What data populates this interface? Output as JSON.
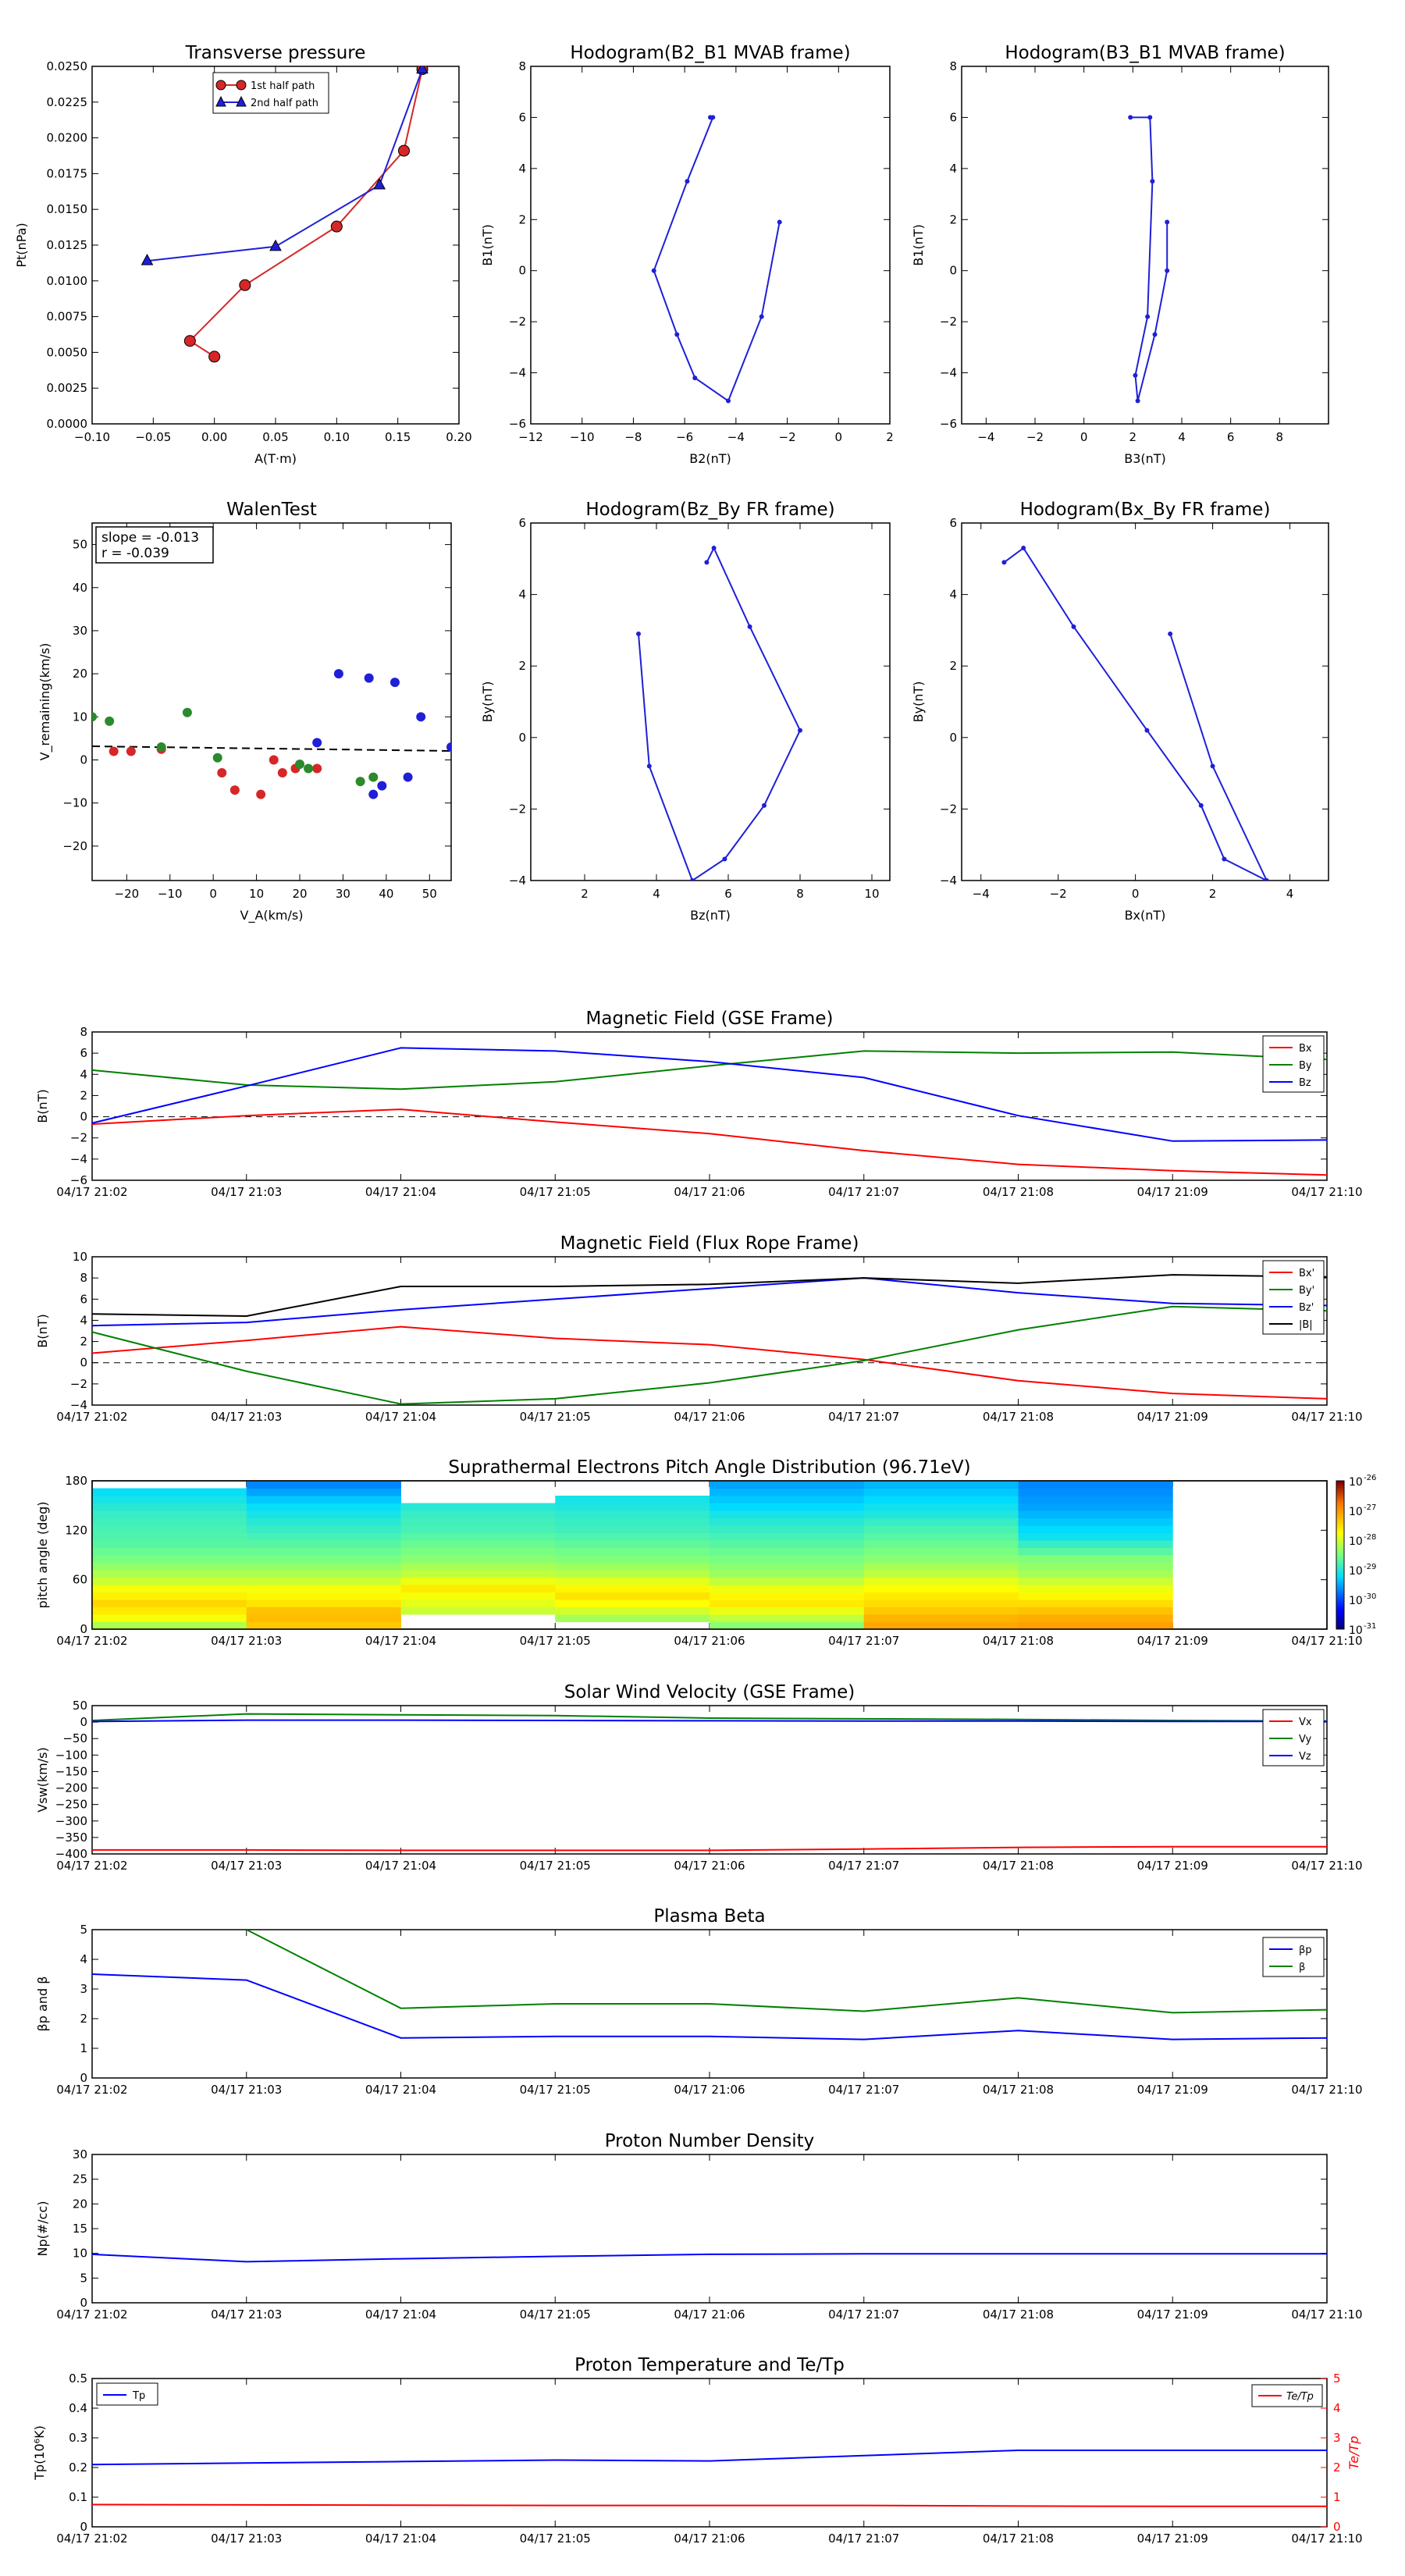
{
  "chart_data": [
    {
      "type": "line",
      "title": "Transverse pressure",
      "xlabel": "A(T·m)",
      "ylabel": "Pt(nPa)",
      "xlim": [
        -0.1,
        0.2
      ],
      "ylim": [
        0,
        0.025
      ],
      "xticks": [
        "−0.10",
        "−0.05",
        "0.00",
        "0.05",
        "0.10",
        "0.15",
        "0.20"
      ],
      "yticks": [
        "0.0000",
        "0.0025",
        "0.0050",
        "0.0075",
        "0.0100",
        "0.0125",
        "0.0150",
        "0.0175",
        "0.0200",
        "0.0225",
        "0.0250"
      ],
      "legend": [
        "1st half path",
        "2nd half path"
      ],
      "series": [
        {
          "name": "1st half path",
          "color": "#d62728",
          "marker": "circle",
          "x": [
            0.0,
            -0.02,
            0.025,
            0.1,
            0.155,
            0.17
          ],
          "y": [
            0.0047,
            0.0058,
            0.0097,
            0.0138,
            0.0191,
            0.0248
          ]
        },
        {
          "name": "2nd half path",
          "color": "#1f1fd8",
          "marker": "triangle",
          "x": [
            -0.055,
            0.05,
            0.135,
            0.17
          ],
          "y": [
            0.0114,
            0.0124,
            0.0167,
            0.0248
          ]
        }
      ]
    },
    {
      "type": "line",
      "title": "Hodogram(B2_B1 MVAB frame)",
      "xlabel": "B2(nT)",
      "ylabel": "B1(nT)",
      "xlim": [
        -12,
        2
      ],
      "ylim": [
        -6,
        8
      ],
      "xticks": [
        "−12",
        "−10",
        "−8",
        "−6",
        "−4",
        "−2",
        "0",
        "2"
      ],
      "yticks": [
        "−6",
        "−4",
        "−2",
        "0",
        "2",
        "4",
        "6",
        "8"
      ],
      "series": [
        {
          "color": "#1f1fd8",
          "x": [
            -2.3,
            -3.0,
            -4.3,
            -5.6,
            -6.3,
            -7.2,
            -5.9,
            -4.9,
            -5.0
          ],
          "y": [
            1.9,
            -1.8,
            -5.1,
            -4.2,
            -2.5,
            0.0,
            3.5,
            6.0,
            6.0
          ]
        }
      ]
    },
    {
      "type": "line",
      "title": "Hodogram(B3_B1 MVAB frame)",
      "xlabel": "B3(nT)",
      "ylabel": "B1(nT)",
      "xlim": [
        -5,
        10
      ],
      "ylim": [
        -6,
        8
      ],
      "xticks": [
        "−4",
        "−2",
        "0",
        "2",
        "4",
        "6",
        "8"
      ],
      "yticks": [
        "−6",
        "−4",
        "−2",
        "0",
        "2",
        "4",
        "6",
        "8"
      ],
      "series": [
        {
          "color": "#1f1fd8",
          "x": [
            3.4,
            3.4,
            2.9,
            2.2,
            2.1,
            2.6,
            2.8,
            2.7,
            1.9
          ],
          "y": [
            1.9,
            0.0,
            -2.5,
            -5.1,
            -4.1,
            -1.8,
            3.5,
            6.0,
            6.0
          ]
        }
      ]
    },
    {
      "type": "scatter",
      "title": "WalenTest",
      "xlabel": "V_A(km/s)",
      "ylabel": "V_remaining(km/s)",
      "xlim": [
        -28,
        55
      ],
      "ylim": [
        -28,
        55
      ],
      "xticks": [
        "−20",
        "−10",
        "0",
        "10",
        "20",
        "30",
        "40",
        "50"
      ],
      "yticks": [
        "−20",
        "−10",
        "0",
        "10",
        "20",
        "30",
        "40",
        "50"
      ],
      "annotation": [
        "slope = -0.013",
        "r = -0.039"
      ],
      "fit_line": {
        "slope": -0.013,
        "intercept": 2.8,
        "style": "dashed"
      },
      "series": [
        {
          "color": "#d62728",
          "x": [
            -23,
            -19,
            -12,
            2,
            5,
            11,
            14,
            16,
            19,
            24
          ],
          "y": [
            2,
            2,
            2.5,
            -3,
            -7,
            -8,
            0,
            -3,
            -2,
            -2
          ]
        },
        {
          "color": "#2b8a2b",
          "x": [
            -28,
            -24,
            -12,
            -6,
            1,
            20,
            22,
            34,
            37
          ],
          "y": [
            10,
            9,
            3,
            11,
            0.5,
            -1,
            -2,
            -5,
            -4
          ]
        },
        {
          "color": "#1f1fd8",
          "x": [
            24,
            29,
            36,
            37,
            39,
            42,
            45,
            48,
            55
          ],
          "y": [
            4,
            20,
            19,
            -8,
            -6,
            18,
            -4,
            10,
            3
          ]
        }
      ]
    },
    {
      "type": "line",
      "title": "Hodogram(Bz_By FR frame)",
      "xlabel": "Bz(nT)",
      "ylabel": "By(nT)",
      "xlim": [
        0.5,
        10.5
      ],
      "ylim": [
        -4,
        6
      ],
      "xticks": [
        "2",
        "4",
        "6",
        "8",
        "10"
      ],
      "yticks": [
        "−4",
        "−2",
        "0",
        "2",
        "4",
        "6"
      ],
      "series": [
        {
          "color": "#1f1fd8",
          "x": [
            5.4,
            5.6,
            6.6,
            8.0,
            7.0,
            5.9,
            5.0,
            3.8,
            3.5
          ],
          "y": [
            4.9,
            5.3,
            3.1,
            0.2,
            -1.9,
            -3.4,
            -4.0,
            -0.8,
            2.9
          ]
        }
      ]
    },
    {
      "type": "line",
      "title": "Hodogram(Bx_By FR frame)",
      "xlabel": "Bx(nT)",
      "ylabel": "By(nT)",
      "xlim": [
        -4.5,
        5
      ],
      "ylim": [
        -4,
        6
      ],
      "xticks": [
        "−4",
        "−2",
        "0",
        "2",
        "4"
      ],
      "yticks": [
        "−4",
        "−2",
        "0",
        "2",
        "4",
        "6"
      ],
      "series": [
        {
          "color": "#1f1fd8",
          "x": [
            -3.4,
            -2.9,
            -1.6,
            0.3,
            1.7,
            2.3,
            3.4,
            2.0,
            0.9
          ],
          "y": [
            4.9,
            5.3,
            3.1,
            0.2,
            -1.9,
            -3.4,
            -4.0,
            -0.8,
            2.9
          ]
        }
      ]
    },
    {
      "type": "line",
      "title": "Magnetic Field (GSE Frame)",
      "ylabel": "B(nT)",
      "ylim": [
        -6,
        8
      ],
      "yticks": [
        "−6",
        "−4",
        "−2",
        "0",
        "2",
        "4",
        "6",
        "8"
      ],
      "x": [
        "04/17 21:02",
        "04/17 21:03",
        "04/17 21:04",
        "04/17 21:05",
        "04/17 21:06",
        "04/17 21:07",
        "04/17 21:08",
        "04/17 21:09",
        "04/17 21:10"
      ],
      "zero_line": true,
      "legend": [
        "Bx",
        "By",
        "Bz"
      ],
      "series": [
        {
          "name": "Bx",
          "color": "#ff0000",
          "values": [
            -0.7,
            0.1,
            0.7,
            -0.5,
            -1.6,
            -3.2,
            -4.5,
            -5.1,
            -5.5
          ]
        },
        {
          "name": "By",
          "color": "#008000",
          "values": [
            4.4,
            3.0,
            2.6,
            3.3,
            4.8,
            6.2,
            6.0,
            6.1,
            5.4
          ]
        },
        {
          "name": "Bz",
          "color": "#0000ff",
          "values": [
            -0.6,
            2.9,
            6.5,
            6.2,
            5.2,
            3.7,
            0.1,
            -2.3,
            -2.2
          ]
        }
      ]
    },
    {
      "type": "line",
      "title": "Magnetic Field (Flux Rope Frame)",
      "ylabel": "B(nT)",
      "ylim": [
        -4,
        10
      ],
      "yticks": [
        "−4",
        "−2",
        "0",
        "2",
        "4",
        "6",
        "8",
        "10"
      ],
      "x": [
        "04/17 21:02",
        "04/17 21:03",
        "04/17 21:04",
        "04/17 21:05",
        "04/17 21:06",
        "04/17 21:07",
        "04/17 21:08",
        "04/17 21:09",
        "04/17 21:10"
      ],
      "zero_line": true,
      "legend": [
        "Bx'",
        "By'",
        "Bz'",
        "|B|"
      ],
      "series": [
        {
          "name": "Bx'",
          "color": "#ff0000",
          "values": [
            0.9,
            2.1,
            3.4,
            2.3,
            1.7,
            0.3,
            -1.7,
            -2.9,
            -3.4
          ]
        },
        {
          "name": "By'",
          "color": "#008000",
          "values": [
            2.9,
            -0.8,
            -3.9,
            -3.4,
            -1.9,
            0.2,
            3.1,
            5.3,
            4.9
          ]
        },
        {
          "name": "Bz'",
          "color": "#0000ff",
          "values": [
            3.5,
            3.8,
            5.0,
            6.0,
            7.0,
            8.0,
            6.6,
            5.6,
            5.4
          ]
        },
        {
          "name": "|B|",
          "color": "#000000",
          "values": [
            4.6,
            4.4,
            7.2,
            7.2,
            7.4,
            8.0,
            7.5,
            8.3,
            8.1
          ]
        }
      ]
    },
    {
      "type": "heatmap",
      "title": "Suprathermal Electrons Pitch Angle Distribution (96.71eV)",
      "ylabel": "pitch angle (deg)",
      "ylim": [
        0,
        180
      ],
      "yticks": [
        "0",
        "60",
        "120",
        "180"
      ],
      "x": [
        "04/17 21:02",
        "04/17 21:03",
        "04/17 21:04",
        "04/17 21:05",
        "04/17 21:06",
        "04/17 21:07",
        "04/17 21:08",
        "04/17 21:09",
        "04/17 21:10"
      ],
      "colorbar_ticks": [
        "10",
        "10",
        "10",
        "10",
        "10",
        "10"
      ],
      "colorbar_exponents": [
        "-26",
        "-27",
        "-28",
        "-29",
        "-30",
        "-31"
      ],
      "bins": 20,
      "columns": [
        {
          "t": 0,
          "v": [
            5.6,
            6.4,
            6.8,
            7.1,
            6.7,
            6.4,
            5.9,
            5.6,
            5.3,
            5.0,
            4.8,
            4.6,
            4.5,
            4.4,
            4.3,
            4.2,
            4.0,
            3.8,
            3.6,
            0
          ]
        },
        {
          "t": 1,
          "v": [
            7.3,
            7.5,
            7.4,
            6.9,
            6.6,
            6.4,
            5.9,
            5.6,
            5.3,
            5.0,
            4.8,
            4.6,
            4.4,
            4.2,
            4.0,
            3.8,
            3.6,
            3.3,
            2.9,
            2.6
          ]
        },
        {
          "t": 2,
          "v": [
            0,
            0,
            5.9,
            6.2,
            6.4,
            6.8,
            6.3,
            5.8,
            5.5,
            5.2,
            5.0,
            4.8,
            4.6,
            4.4,
            4.3,
            4.2,
            4.0,
            0,
            0,
            0
          ]
        },
        {
          "t": 3,
          "v": [
            0,
            5.5,
            6.0,
            6.5,
            6.9,
            6.6,
            6.2,
            5.7,
            5.4,
            5.1,
            4.9,
            4.7,
            4.5,
            4.3,
            4.2,
            4.1,
            3.9,
            3.8,
            0,
            0
          ]
        },
        {
          "t": 4,
          "v": [
            5.2,
            5.8,
            6.3,
            6.8,
            6.6,
            6.3,
            5.8,
            5.4,
            5.2,
            5.0,
            4.8,
            4.6,
            4.4,
            4.2,
            4.0,
            3.8,
            3.5,
            3.3,
            3.1,
            2.9
          ]
        },
        {
          "t": 5,
          "v": [
            7.8,
            7.6,
            7.3,
            7.0,
            6.8,
            6.5,
            6.2,
            5.8,
            5.5,
            5.2,
            5.0,
            4.8,
            4.6,
            4.4,
            4.2,
            3.9,
            3.7,
            3.5,
            3.3,
            3.1
          ]
        },
        {
          "t": 6,
          "v": [
            7.9,
            7.7,
            7.4,
            7.0,
            6.6,
            6.3,
            5.9,
            5.5,
            5.3,
            5.1,
            4.6,
            4.2,
            3.7,
            3.5,
            3.3,
            3.1,
            2.9,
            2.8,
            2.7,
            2.6
          ]
        }
      ]
    },
    {
      "type": "line",
      "title": "Solar Wind Velocity (GSE Frame)",
      "ylabel": "Vsw(km/s)",
      "ylim": [
        -400,
        50
      ],
      "yticks": [
        "−400",
        "−350",
        "−300",
        "−250",
        "−200",
        "−150",
        "−100",
        "−50",
        "0",
        "50"
      ],
      "x": [
        "04/17 21:02",
        "04/17 21:03",
        "04/17 21:04",
        "04/17 21:05",
        "04/17 21:06",
        "04/17 21:07",
        "04/17 21:08",
        "04/17 21:09",
        "04/17 21:10"
      ],
      "legend": [
        "Vx",
        "Vy",
        "Vz"
      ],
      "series": [
        {
          "name": "Vx",
          "color": "#ff0000",
          "values": [
            -388,
            -388,
            -389,
            -389,
            -389,
            -385,
            -380,
            -378,
            -378
          ]
        },
        {
          "name": "Vy",
          "color": "#008000",
          "values": [
            5,
            25,
            22,
            20,
            12,
            10,
            8,
            5,
            3
          ]
        },
        {
          "name": "Vz",
          "color": "#0000ff",
          "values": [
            2,
            6,
            6,
            5,
            4,
            3,
            3,
            2,
            2
          ]
        }
      ]
    },
    {
      "type": "line",
      "title": "Plasma Beta",
      "ylabel": "βp and β",
      "ylim": [
        0,
        5
      ],
      "yticks": [
        "0",
        "1",
        "2",
        "3",
        "4",
        "5"
      ],
      "x": [
        "04/17 21:02",
        "04/17 21:03",
        "04/17 21:04",
        "04/17 21:05",
        "04/17 21:06",
        "04/17 21:07",
        "04/17 21:08",
        "04/17 21:09",
        "04/17 21:10"
      ],
      "legend": [
        "βp",
        "β"
      ],
      "series": [
        {
          "name": "βp",
          "color": "#0000ff",
          "values": [
            3.5,
            3.3,
            1.35,
            1.4,
            1.4,
            1.3,
            1.6,
            1.3,
            1.35
          ]
        },
        {
          "name": "β",
          "color": "#008000",
          "values": [
            null,
            5.0,
            2.35,
            2.5,
            2.5,
            2.25,
            2.7,
            2.2,
            2.3
          ]
        }
      ]
    },
    {
      "type": "line",
      "title": "Proton Number Density",
      "ylabel": "Np(#/cc)",
      "ylim": [
        0,
        30
      ],
      "yticks": [
        "0",
        "5",
        "10",
        "15",
        "20",
        "25",
        "30"
      ],
      "x": [
        "04/17 21:02",
        "04/17 21:03",
        "04/17 21:04",
        "04/17 21:05",
        "04/17 21:06",
        "04/17 21:07",
        "04/17 21:08",
        "04/17 21:09",
        "04/17 21:10"
      ],
      "series": [
        {
          "color": "#0000ff",
          "values": [
            9.8,
            8.3,
            8.9,
            9.4,
            9.8,
            9.9,
            9.9,
            9.9,
            9.9
          ]
        }
      ]
    },
    {
      "type": "line",
      "title": "Proton Temperature and Te/Tp",
      "ylabel": "Tp(10⁶K)",
      "ylabel_right": "Te/Tp",
      "ylim": [
        0,
        0.5
      ],
      "ylim_right": [
        0,
        5
      ],
      "yticks": [
        "0",
        "0.1",
        "0.2",
        "0.3",
        "0.4",
        "0.5"
      ],
      "yticks_right": [
        "0",
        "1",
        "2",
        "3",
        "4",
        "5"
      ],
      "x": [
        "04/17 21:02",
        "04/17 21:03",
        "04/17 21:04",
        "04/17 21:05",
        "04/17 21:06",
        "04/17 21:07",
        "04/17 21:08",
        "04/17 21:09",
        "04/17 21:10"
      ],
      "legend": [
        "Tp",
        "Te/Tp"
      ],
      "series": [
        {
          "name": "Tp",
          "axis": "left",
          "color": "#0000ff",
          "values": [
            0.21,
            0.215,
            0.22,
            0.225,
            0.222,
            0.24,
            0.258,
            0.258,
            0.258
          ]
        },
        {
          "name": "Te/Tp",
          "axis": "right",
          "color": "#ff0000",
          "values": [
            0.75,
            0.74,
            0.73,
            0.72,
            0.72,
            0.72,
            0.7,
            0.69,
            0.69
          ]
        }
      ]
    }
  ]
}
